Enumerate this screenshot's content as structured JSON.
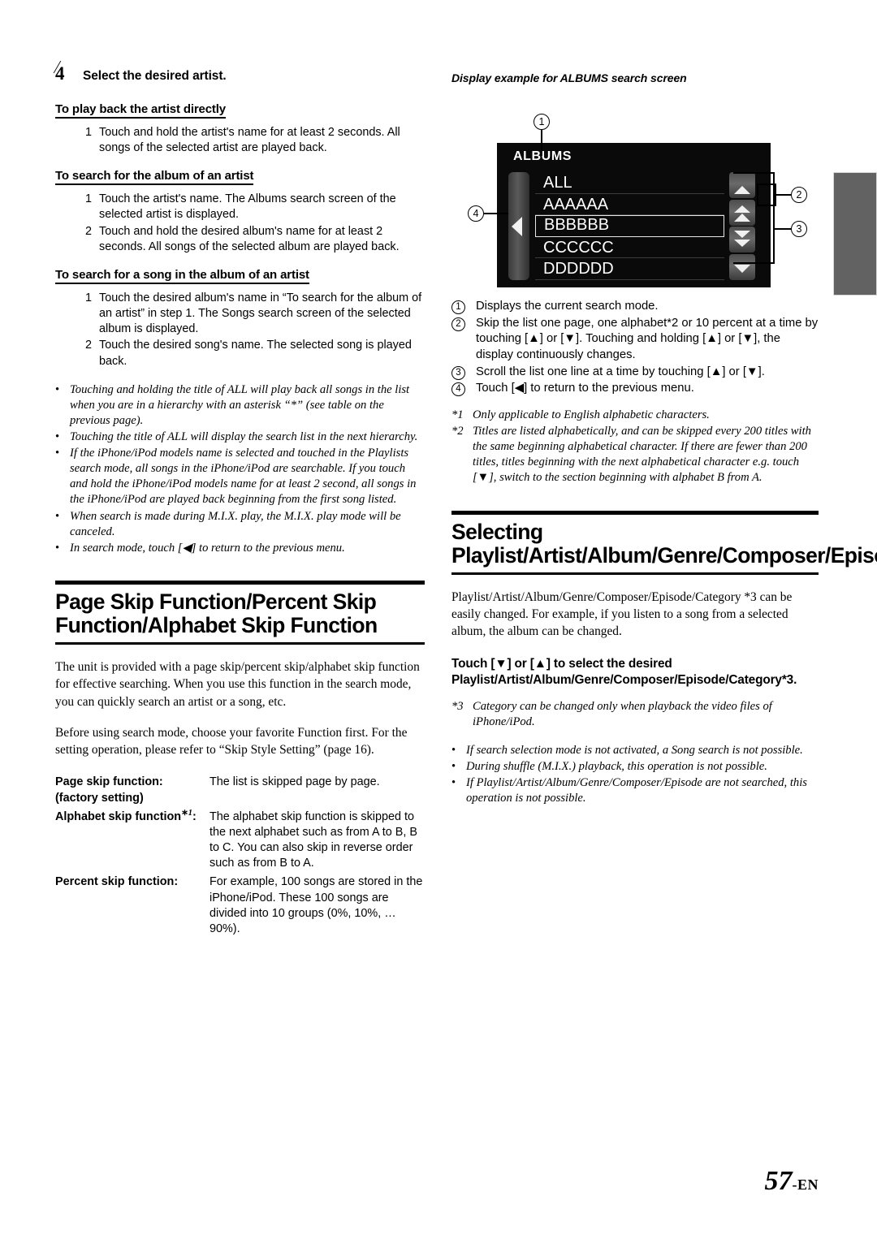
{
  "page": {
    "number": "57",
    "lang_suffix": "-EN"
  },
  "left": {
    "step": {
      "number": "4",
      "title": "Select the desired artist."
    },
    "sections": [
      {
        "heading": "To play back the artist directly",
        "items": [
          {
            "n": "1",
            "text": "Touch and hold the artist's name for at least 2 seconds. All songs of the selected artist are played back."
          }
        ]
      },
      {
        "heading": "To search for the album of an artist",
        "items": [
          {
            "n": "1",
            "text": "Touch the artist's name. The Albums search screen of the selected artist is displayed."
          },
          {
            "n": "2",
            "text": "Touch and hold the desired album's name for at least 2 seconds. All songs of the selected album are played back."
          }
        ]
      },
      {
        "heading": "To search for a song in the album of an artist",
        "items": [
          {
            "n": "1",
            "text": "Touch the desired album's name in “To search for the album of an artist” in step 1. The Songs search screen of the selected album is displayed."
          },
          {
            "n": "2",
            "text": "Touch the desired song's name. The selected song is played back."
          }
        ]
      }
    ],
    "notes": [
      "Touching and holding the title of ALL will play back all songs in the list when you are in a hierarchy with an asterisk “*” (see table on the previous page).",
      "Touching the title of ALL will display the search list in the next hierarchy.",
      "If the iPhone/iPod models name is selected and touched in the Playlists search mode, all songs in the iPhone/iPod are searchable. If you touch and hold the iPhone/iPod models name for at least 2 second, all songs in the iPhone/iPod are played back beginning from the first song listed.",
      "When search is made during M.I.X. play, the M.I.X. play mode will be canceled.",
      "In search mode, touch [◀] to return to the previous menu."
    ],
    "section_heading": "Page Skip Function/Percent Skip Function/Alphabet Skip Function",
    "paragraphs": [
      "The unit is provided with a page skip/percent skip/alphabet skip function for effective searching. When you use this function in the search mode, you can quickly search an artist or a song, etc.",
      "Before using search mode, choose your favorite Function first. For the setting operation, please refer to “Skip Style Setting” (page 16)."
    ],
    "definitions": [
      {
        "term": "Page skip function:",
        "term2": "(factory setting)",
        "footnote": "",
        "desc": "The list is skipped page by page."
      },
      {
        "term": "Alphabet skip function",
        "term2": "",
        "footnote": "*1",
        "term_suffix": ":",
        "desc": "The alphabet skip function is skipped to the next alphabet such as from A to B, B to C. You can also skip in reverse order such as from B to A."
      },
      {
        "term": "Percent skip function:",
        "term2": "",
        "footnote": "",
        "desc": "For example, 100 songs are stored in the iPhone/iPod. These 100 songs are divided into 10 groups (0%, 10%, … 90%)."
      }
    ]
  },
  "right": {
    "display_caption": "Display example for ALBUMS search screen",
    "screen": {
      "title": "ALBUMS",
      "rows": [
        {
          "label": "ALL",
          "selected": false
        },
        {
          "label": "AAAAAA",
          "selected": false
        },
        {
          "label": "BBBBBB",
          "selected": true
        },
        {
          "label": "CCCCCC",
          "selected": false
        },
        {
          "label": "DDDDDD",
          "selected": false
        }
      ],
      "buttons": [
        "single-up-arrow",
        "double-up-arrow",
        "double-down-arrow",
        "single-down-arrow"
      ],
      "back_button": "left-arrow",
      "callouts": [
        "1",
        "2",
        "3",
        "4"
      ]
    },
    "explanations": [
      {
        "n": "1",
        "text": "Displays the current search mode."
      },
      {
        "n": "2",
        "text": "Skip the list one page, one alphabet*2 or 10 percent at a time by touching [▲] or [▼]. Touching and holding [▲] or [▼], the display continuously changes."
      },
      {
        "n": "3",
        "text": "Scroll the list one line at a time by touching [▲] or [▼]."
      },
      {
        "n": "4",
        "text": "Touch [◀] to return to the previous menu."
      }
    ],
    "footnotes": [
      {
        "mark": "*1",
        "text": "Only applicable to English alphabetic characters."
      },
      {
        "mark": "*2",
        "text": "Titles are listed alphabetically, and can be skipped every 200 titles with the same beginning alphabetical character. If there are fewer than 200 titles, titles beginning with the next alphabetical character e.g. touch [▼], switch to the section beginning with alphabet B from A."
      }
    ],
    "section_heading": "Selecting Playlist/Artist/Album/Genre/Composer/Episode/Category",
    "paragraph": "Playlist/Artist/Album/Genre/Composer/Episode/Category *3 can be easily changed. For example, if you listen to a song from a selected album, the album can be changed.",
    "touch_heading": "Touch [▼] or [▲] to select the desired Playlist/Artist/Album/Genre/Composer/Episode/Category*3.",
    "footnote3": {
      "mark": "*3",
      "text": "Category can be changed only when playback the video files of iPhone/iPod."
    },
    "notes": [
      "If search selection mode is not activated, a Song search is not possible.",
      "During shuffle (M.I.X.) playback, this operation is not possible.",
      "If Playlist/Artist/Album/Genre/Composer/Episode are not searched, this operation is not possible."
    ]
  }
}
